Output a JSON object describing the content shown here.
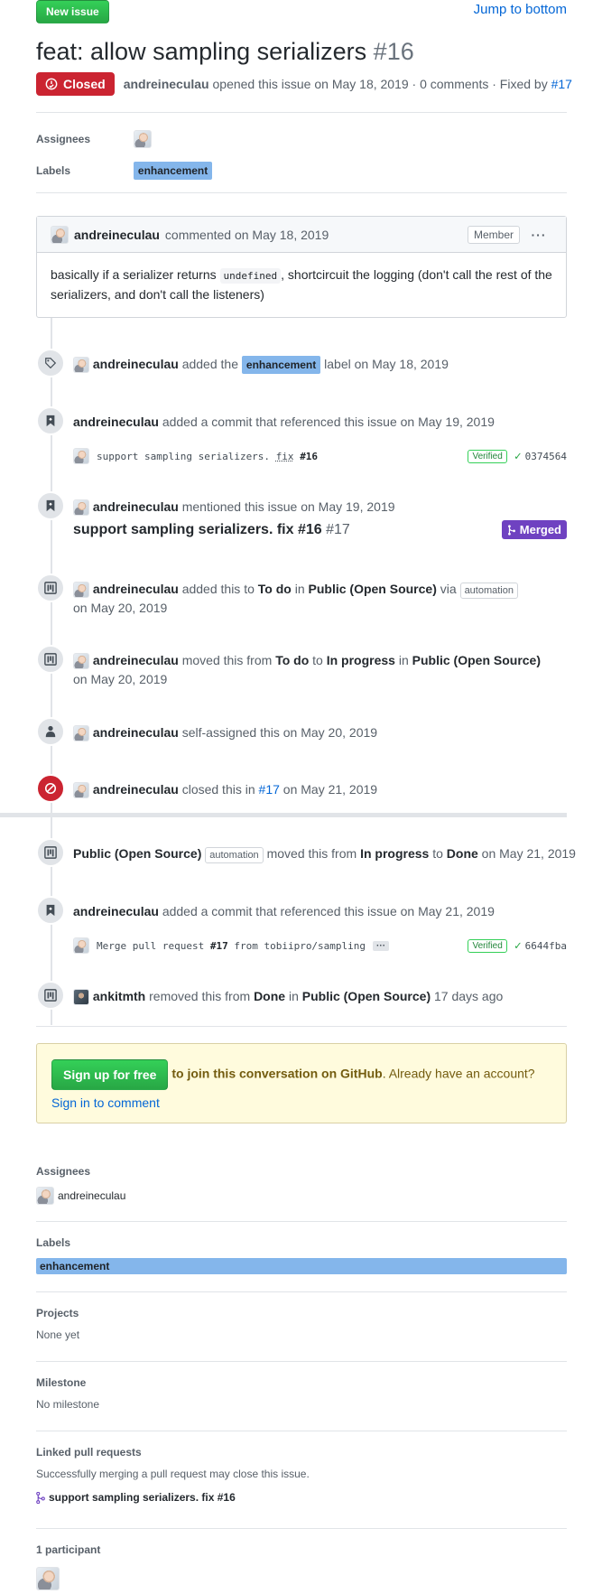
{
  "top": {
    "new_issue": "New issue",
    "jump": "Jump to bottom"
  },
  "issue": {
    "title": "feat: allow sampling serializers",
    "number": "#16",
    "state": "Closed",
    "author": "andreineculau",
    "meta_text": "opened this issue on May 18, 2019 · 0 comments · Fixed by",
    "fixed_by": "#17"
  },
  "header_sidebar": {
    "assignees_label": "Assignees",
    "labels_label": "Labels",
    "label": "enhancement"
  },
  "comment": {
    "author": "andreineculau",
    "action": "commented on May 18, 2019",
    "badge": "Member",
    "menu": "···",
    "body_pre": "basically if a serializer returns",
    "body_code": "undefined",
    "body_post": ", shortcircuit the logging (don't call the rest of the serializers, and don't call the listeners)"
  },
  "events": {
    "e1": {
      "actor": "andreineculau",
      "t1": "added the",
      "label": "enhancement",
      "t2": "label on May 18, 2019"
    },
    "e2": {
      "actor": "andreineculau",
      "t1": "added a commit that referenced this issue on May 19, 2019",
      "commit_pre": "support sampling serializers.",
      "commit_fix": "fix",
      "commit_ref": "#16",
      "verified": "Verified",
      "sha": "0374564"
    },
    "e3": {
      "actor": "andreineculau",
      "t1": "mentioned this issue on May 19, 2019",
      "pr_title": "support sampling serializers. fix #16",
      "pr_num": "#17",
      "merged": "Merged"
    },
    "e4": {
      "actor": "andreineculau",
      "t1": "added this to",
      "col": "To do",
      "t2": "in",
      "project": "Public (Open Source)",
      "t3": "via",
      "pill": "automation",
      "date": "on May 20, 2019"
    },
    "e5": {
      "actor": "andreineculau",
      "t1": "moved this from",
      "from": "To do",
      "t2": "to",
      "to": "In progress",
      "t3": "in",
      "project": "Public (Open Source)",
      "date": "on May 20, 2019"
    },
    "e6": {
      "actor": "andreineculau",
      "t1": "self-assigned this on May 20, 2019"
    },
    "e7": {
      "actor": "andreineculau",
      "t1": "closed this in",
      "ref": "#17",
      "t2": "on May 21, 2019"
    },
    "e8": {
      "project": "Public (Open Source)",
      "pill": "automation",
      "t1": "moved this from",
      "from": "In progress",
      "t2": "to",
      "to": "Done",
      "t3": "on May 21, 2019"
    },
    "e9": {
      "actor": "andreineculau",
      "t1": "added a commit that referenced this issue on May 21, 2019",
      "commit_pre": "Merge pull request",
      "commit_ref": "#17",
      "commit_post": "from tobiipro/sampling",
      "ellip": "···",
      "verified": "Verified",
      "sha": "6644fba"
    },
    "e10": {
      "actor": "ankitmth",
      "t1": "removed this from",
      "col": "Done",
      "t2": "in",
      "project": "Public (Open Source)",
      "t3": "17 days ago"
    }
  },
  "signup": {
    "button": "Sign up for free",
    "bold": "to join this conversation on GitHub",
    "text": ". Already have an account?",
    "link": "Sign in to comment"
  },
  "sidebar": {
    "assignees_title": "Assignees",
    "assignee": "andreineculau",
    "labels_title": "Labels",
    "label": "enhancement",
    "projects_title": "Projects",
    "projects_value": "None yet",
    "milestone_title": "Milestone",
    "milestone_value": "No milestone",
    "linked_title": "Linked pull requests",
    "linked_desc": "Successfully merging a pull request may close this issue.",
    "linked_pr": "support sampling serializers. fix #16",
    "participants_title": "1 participant"
  },
  "colors": {
    "closed": "#cb2431",
    "merged": "#6f42c1",
    "label": "#84b6eb",
    "green": "#28a745",
    "link": "#0366d6"
  }
}
